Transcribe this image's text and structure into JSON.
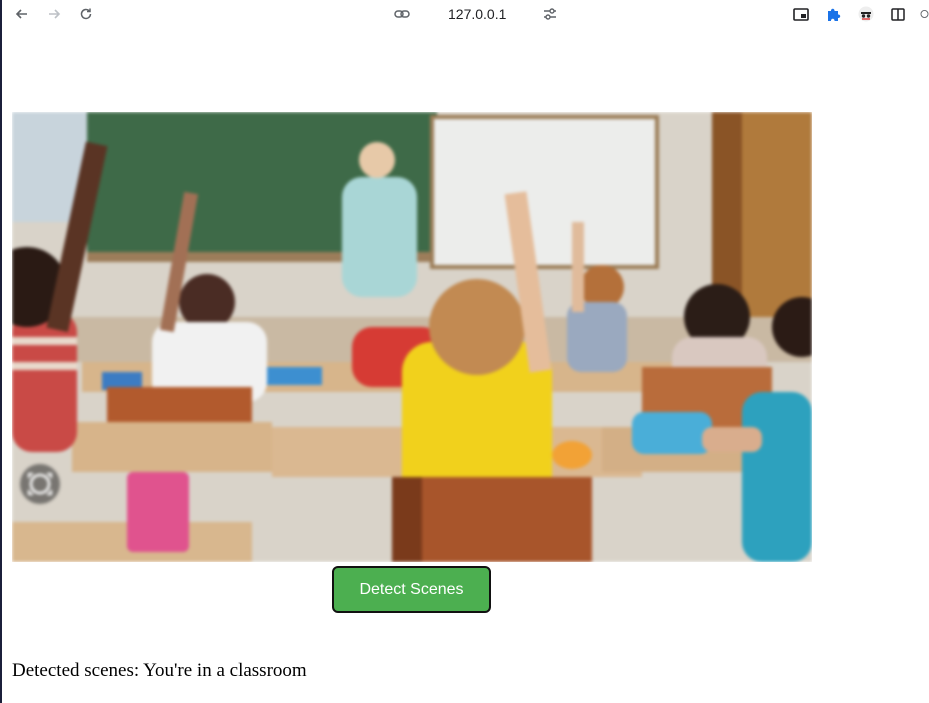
{
  "browser": {
    "url": "127.0.0.1"
  },
  "icons": {
    "back": "arrow-left-icon",
    "forward": "arrow-right-icon",
    "reload": "reload-icon",
    "site_info": "link-icon",
    "tune": "tune-icon",
    "pip": "picture-in-picture-icon",
    "extensions": "puzzle-icon",
    "profile": "profile-icon",
    "sidepanel": "side-panel-icon",
    "menu": "menu-icon",
    "camera": "camera-icon"
  },
  "image": {
    "description_alt": "classroom"
  },
  "actions": {
    "detect_label": "Detect Scenes"
  },
  "result": {
    "text": "Detected scenes: You're in a classroom"
  },
  "colors": {
    "button": "#4caf50",
    "accent_blue": "#1a73e8"
  }
}
